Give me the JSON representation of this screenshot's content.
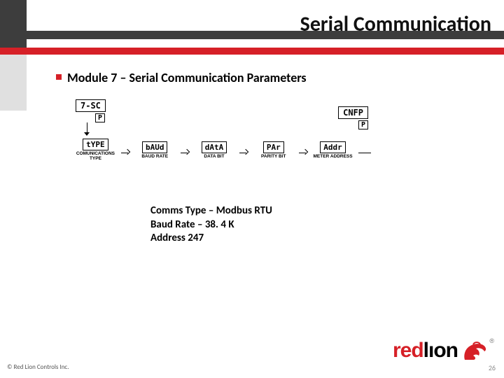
{
  "header": {
    "title": "Serial Communication"
  },
  "bullet": {
    "text": "Module 7 – Serial Communication Parameters"
  },
  "diagram": {
    "start_box": "7-SC",
    "end_box": "CNFP",
    "p_key": "P",
    "params": [
      {
        "lcd": "tYPE",
        "label": "COMUNICATIONS TYPE"
      },
      {
        "lcd": "bAUd",
        "label": "BAUD RATE"
      },
      {
        "lcd": "dAtA",
        "label": "DATA BIT"
      },
      {
        "lcd": "PAr",
        "label": "PARITY BIT"
      },
      {
        "lcd": "Addr",
        "label": "METER ADDRESS"
      }
    ]
  },
  "values": {
    "line1": "Comms Type – Modbus RTU",
    "line2": "Baud Rate – 38. 4 K",
    "line3": "Address 247"
  },
  "logo": {
    "red": "red",
    "lion": "lıon"
  },
  "footer": {
    "copyright": "© Red Lion Controls Inc.",
    "page": "26"
  }
}
